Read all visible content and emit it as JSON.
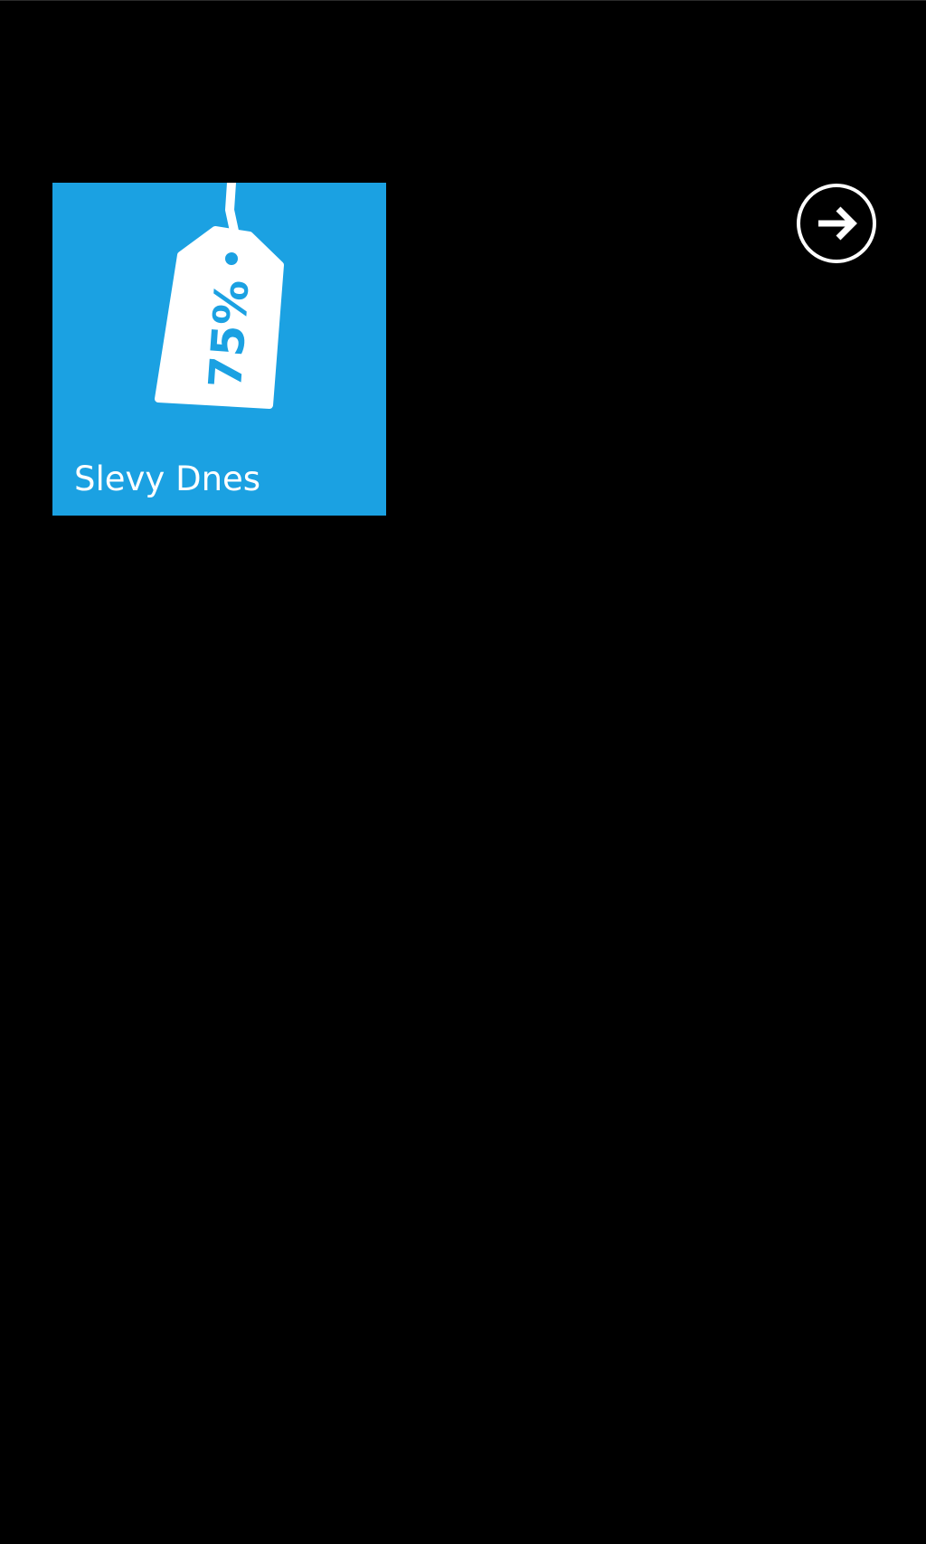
{
  "tile": {
    "label": "Slevy Dnes",
    "tag_text": "75%",
    "tag_icon": "price-tag-icon",
    "color": "#1ba1e2"
  },
  "next_button": {
    "icon": "arrow-right-circle-icon",
    "color": "#ffffff"
  },
  "background_color": "#000000"
}
